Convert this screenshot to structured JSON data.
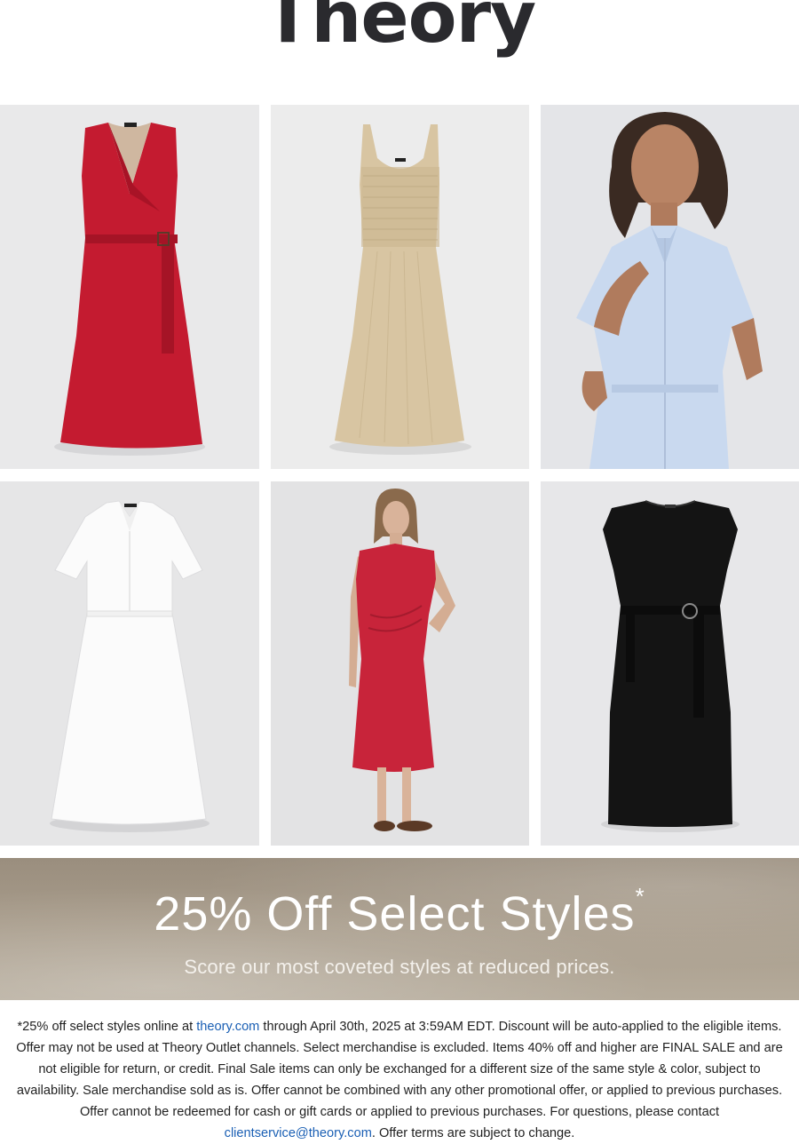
{
  "brand": {
    "logo_text": "Theory"
  },
  "products": [
    {
      "name": "red-belted-wrap-dress",
      "color": "#c21a2f"
    },
    {
      "name": "beige-smocked-knit-dress",
      "color": "#d9c6a3"
    },
    {
      "name": "light-blue-shirt-dress",
      "color": "#c9daf1"
    },
    {
      "name": "white-belted-shirt-dress",
      "color": "#fbfbfb"
    },
    {
      "name": "red-ruched-midi-dress",
      "color": "#c8243a"
    },
    {
      "name": "black-belted-shift-dress",
      "color": "#151515"
    }
  ],
  "promo": {
    "headline": "25% Off Select Styles",
    "asterisk": "*",
    "subline": "Score our most coveted styles at reduced prices."
  },
  "disclaimer": {
    "part1": "*25% off select styles online at ",
    "link1": "theory.com",
    "part2": " through April 30th, 2025 at 3:59AM EDT. Discount will be auto-applied to the eligible items. Offer may not be used at Theory Outlet channels. Select merchandise is excluded. Items 40% off and higher are FINAL SALE and are not eligible for return, or credit. Final Sale items can only be exchanged for a different size of the same style & color, subject to availability. Sale merchandise sold as is. Offer cannot be combined with any other promotional offer, or applied to previous purchases. Offer cannot be redeemed for cash or gift cards or applied to previous purchases. For questions, please contact ",
    "link2": "clientservice@theory.com",
    "part3": ". Offer terms are subject to change."
  },
  "colors": {
    "link": "#1a5fb4",
    "banner_base": "#a79b8a",
    "tile_background": "#e8e8e8"
  }
}
